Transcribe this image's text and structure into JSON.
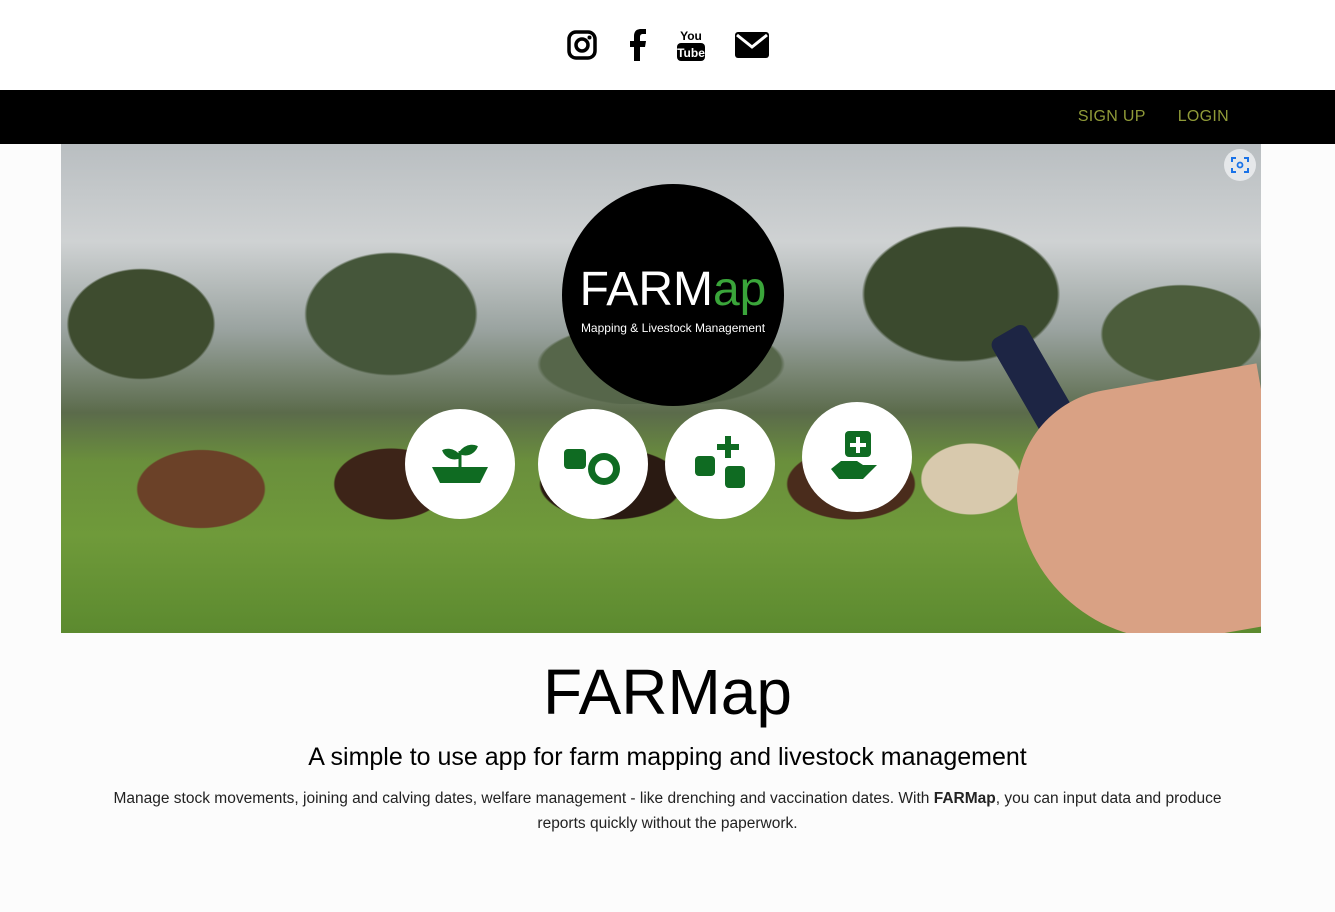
{
  "social": {
    "icons": [
      "instagram-icon",
      "facebook-icon",
      "youtube-icon",
      "email-icon"
    ]
  },
  "nav": {
    "signup": "SIGN UP",
    "login": "LOGIN"
  },
  "hero": {
    "logo_title_1": "FARM",
    "logo_title_2": "ap",
    "logo_subtitle": "Mapping & Livestock Management",
    "features": [
      "feed-trough-icon",
      "cattle-sheep-icon",
      "cattle-health-icon",
      "medical-care-icon"
    ]
  },
  "main": {
    "title": "FARMap",
    "subtitle": "A simple to use app for farm mapping and livestock management",
    "desc_before": "Manage stock movements, joining and calving dates, welfare management - like drenching and vaccination dates. With ",
    "desc_brand": "FARMap",
    "desc_after": ", you can input data and produce reports quickly without the paperwork."
  },
  "colors": {
    "nav_link": "#8f9a38",
    "logo_green": "#3aa53a",
    "icon_green": "#0f6b22"
  }
}
